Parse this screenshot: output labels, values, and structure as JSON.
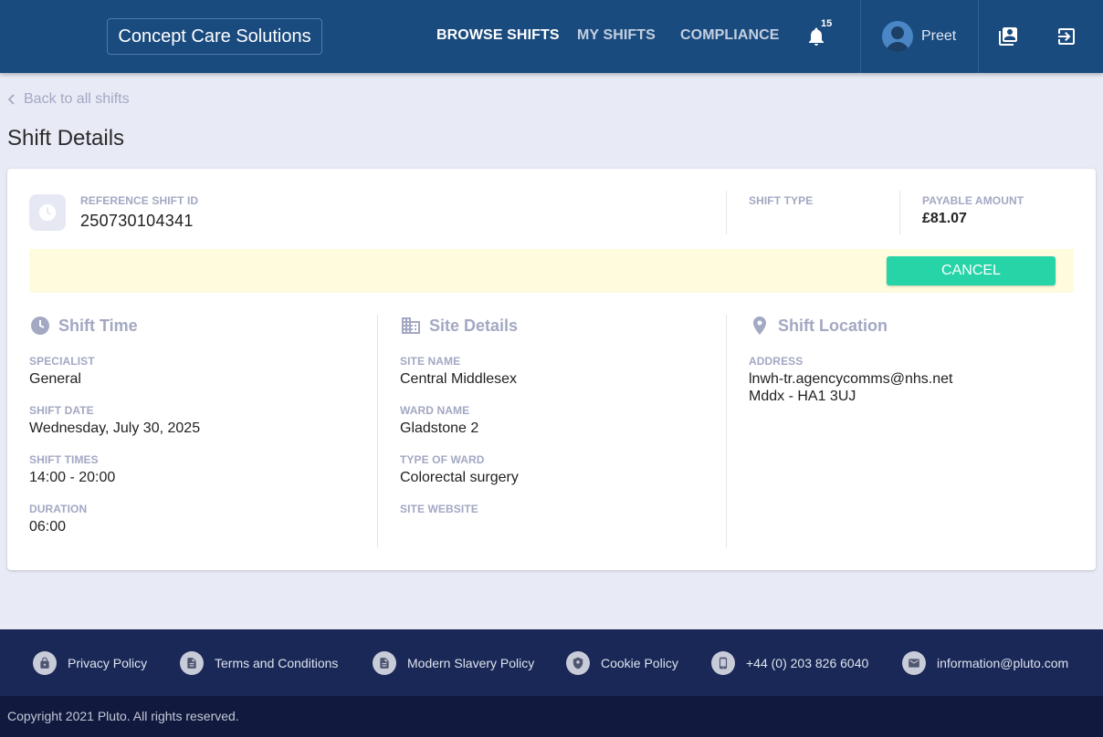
{
  "header": {
    "brand": "Concept Care Solutions",
    "nav": [
      "BROWSE SHIFTS",
      "MY SHIFTS",
      "COMPLIANCE"
    ],
    "notification_count": "15",
    "user_name": "Preet"
  },
  "back_link": "Back to all shifts",
  "page_title": "Shift Details",
  "card": {
    "reference_label": "REFERENCE SHIFT ID",
    "reference_value": "250730104341",
    "shift_type_label": "SHIFT TYPE",
    "shift_type_value": "",
    "payable_label": "PAYABLE AMOUNT",
    "payable_value": "£81.07",
    "cancel_label": "CANCEL"
  },
  "shift_time": {
    "title": "Shift Time",
    "specialist_label": "SPECIALIST",
    "specialist": "General",
    "date_label": "SHIFT DATE",
    "date": "Wednesday, July 30, 2025",
    "times_label": "SHIFT TIMES",
    "times": "14:00 - 20:00",
    "duration_label": "DURATION",
    "duration": "06:00"
  },
  "site_details": {
    "title": "Site Details",
    "site_name_label": "SITE NAME",
    "site_name": "Central Middlesex",
    "ward_name_label": "WARD NAME",
    "ward_name": "Gladstone 2",
    "ward_type_label": "TYPE OF WARD",
    "ward_type": "Colorectal surgery",
    "website_label": "SITE WEBSITE",
    "website": ""
  },
  "shift_location": {
    "title": "Shift Location",
    "address_label": "ADDRESS",
    "address_line1": "lnwh-tr.agencycomms@nhs.net",
    "address_line2": "Mddx - HA1 3UJ"
  },
  "footer": {
    "privacy": "Privacy Policy",
    "terms": "Terms and Conditions",
    "slavery": "Modern Slavery Policy",
    "cookie": "Cookie Policy",
    "phone": "+44 (0) 203 826 6040",
    "email": "information@pluto.com",
    "copyright": "Copyright 2021 Pluto. All rights reserved."
  },
  "colors": {
    "header_bg": "#1a4b7e",
    "page_bg": "#e8eaf6",
    "accent": "#26d4a7",
    "label": "#a3a8c3",
    "banner": "#fffbdd",
    "footer_bg": "#192856",
    "copyright_bg": "#111a3e"
  },
  "icons": [
    "bell-icon",
    "user-avatar-icon",
    "contacts-icon",
    "logout-icon",
    "chevron-left-icon",
    "clock-icon",
    "building-icon",
    "location-pin-icon",
    "lock-icon",
    "document-icon",
    "shield-icon",
    "phone-icon",
    "mail-icon"
  ]
}
